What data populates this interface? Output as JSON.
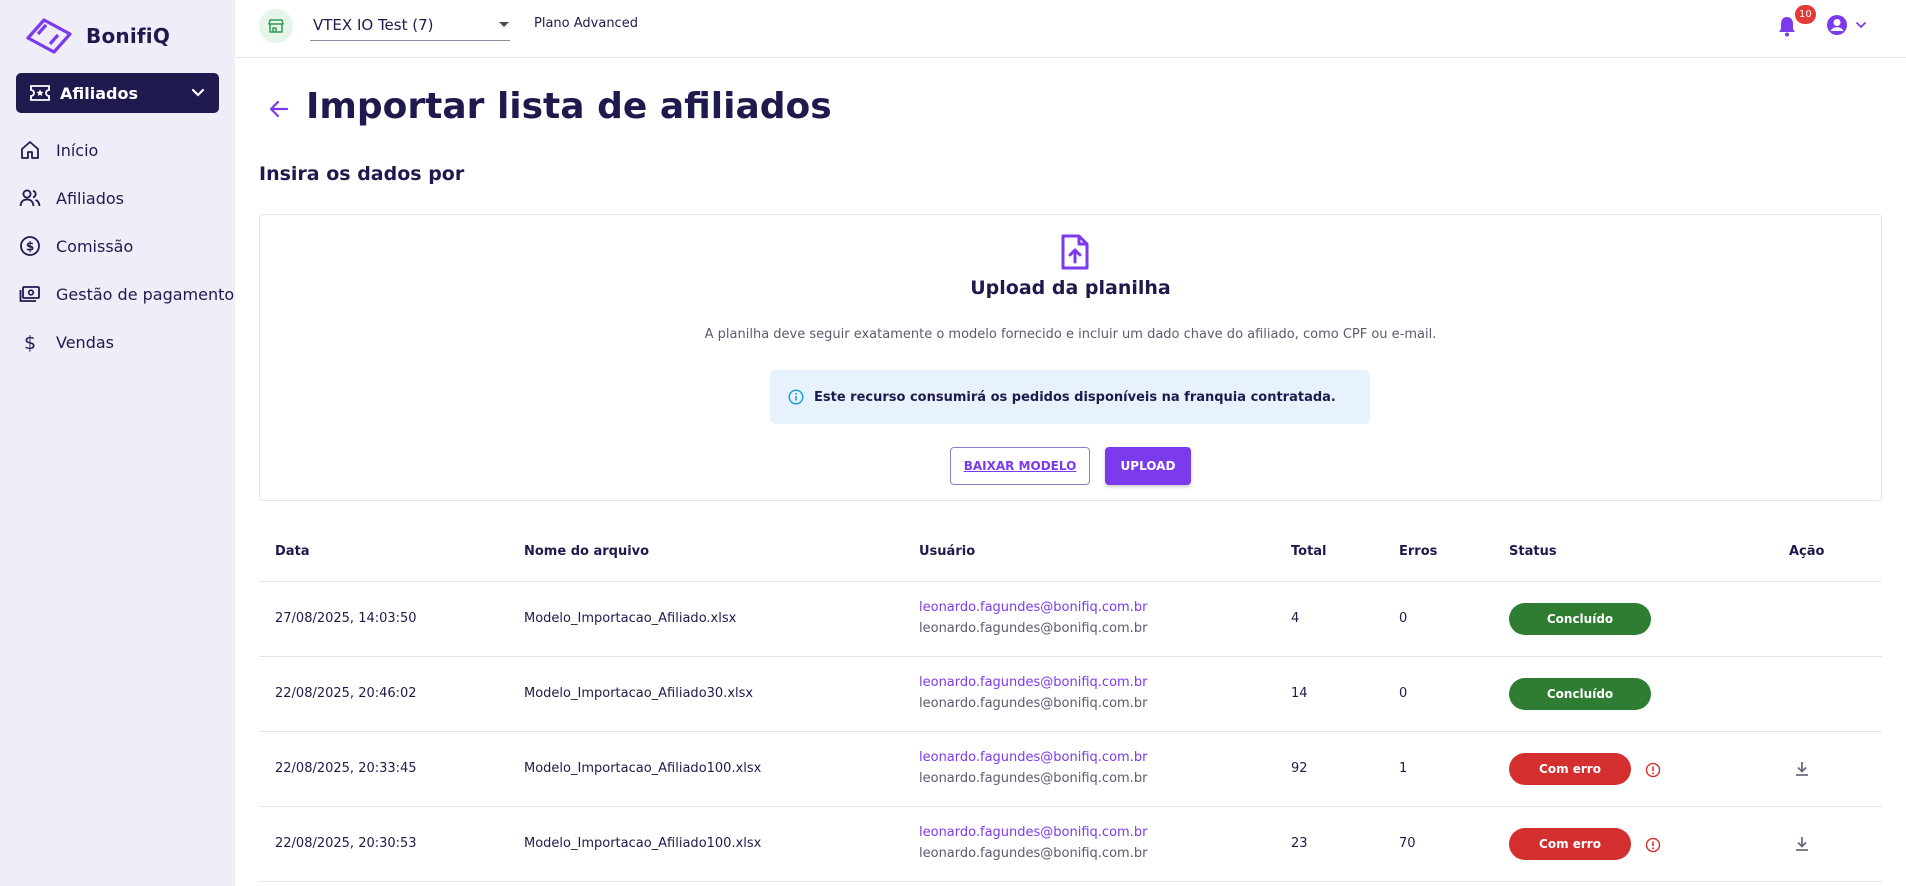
{
  "app": {
    "name": "BonifiQ"
  },
  "sidebar": {
    "module_label": "Afiliados",
    "items": [
      {
        "label": "Início",
        "icon": "home-icon"
      },
      {
        "label": "Afiliados",
        "icon": "users-icon"
      },
      {
        "label": "Comissão",
        "icon": "dollar-circle-icon"
      },
      {
        "label": "Gestão de pagamento",
        "icon": "payment-icon"
      },
      {
        "label": "Vendas",
        "icon": "dollar-icon"
      }
    ]
  },
  "topbar": {
    "store": "VTEX IO Test (7)",
    "plan": "Plano Advanced",
    "notifications": "10"
  },
  "page": {
    "title": "Importar lista de afiliados",
    "section_title": "Insira os dados por"
  },
  "upload": {
    "title": "Upload da planilha",
    "description": "A planilha deve seguir exatamente o modelo fornecido e incluir um dado chave do afiliado, como CPF ou e-mail.",
    "info": "Este recurso consumirá os pedidos disponíveis na franquia contratada.",
    "download_label": "BAIXAR MODELO",
    "upload_label": "UPLOAD"
  },
  "table": {
    "columns": [
      "Data",
      "Nome do arquivo",
      "Usuário",
      "Total",
      "Erros",
      "Status",
      "Ação"
    ],
    "rows": [
      {
        "date": "27/08/2025, 14:03:50",
        "file": "Modelo_Importacao_Afiliado.xlsx",
        "user": "leonardo.fagundes@bonifiq.com.br",
        "user_sub": "leonardo.fagundes@bonifiq.com.br",
        "total": "4",
        "errors": "0",
        "status": "Concluído",
        "status_type": "ok"
      },
      {
        "date": "22/08/2025, 20:46:02",
        "file": "Modelo_Importacao_Afiliado30.xlsx",
        "user": "leonardo.fagundes@bonifiq.com.br",
        "user_sub": "leonardo.fagundes@bonifiq.com.br",
        "total": "14",
        "errors": "0",
        "status": "Concluído",
        "status_type": "ok"
      },
      {
        "date": "22/08/2025, 20:33:45",
        "file": "Modelo_Importacao_Afiliado100.xlsx",
        "user": "leonardo.fagundes@bonifiq.com.br",
        "user_sub": "leonardo.fagundes@bonifiq.com.br",
        "total": "92",
        "errors": "1",
        "status": "Com erro",
        "status_type": "err"
      },
      {
        "date": "22/08/2025, 20:30:53",
        "file": "Modelo_Importacao_Afiliado100.xlsx",
        "user": "leonardo.fagundes@bonifiq.com.br",
        "user_sub": "leonardo.fagundes@bonifiq.com.br",
        "total": "23",
        "errors": "70",
        "status": "Com erro",
        "status_type": "err"
      }
    ]
  },
  "colors": {
    "brand": "#7c3aed",
    "navy": "#1f1a4d",
    "sidebar_bg": "#eeedf8",
    "success": "#2e7d32",
    "error": "#d32f2f"
  }
}
